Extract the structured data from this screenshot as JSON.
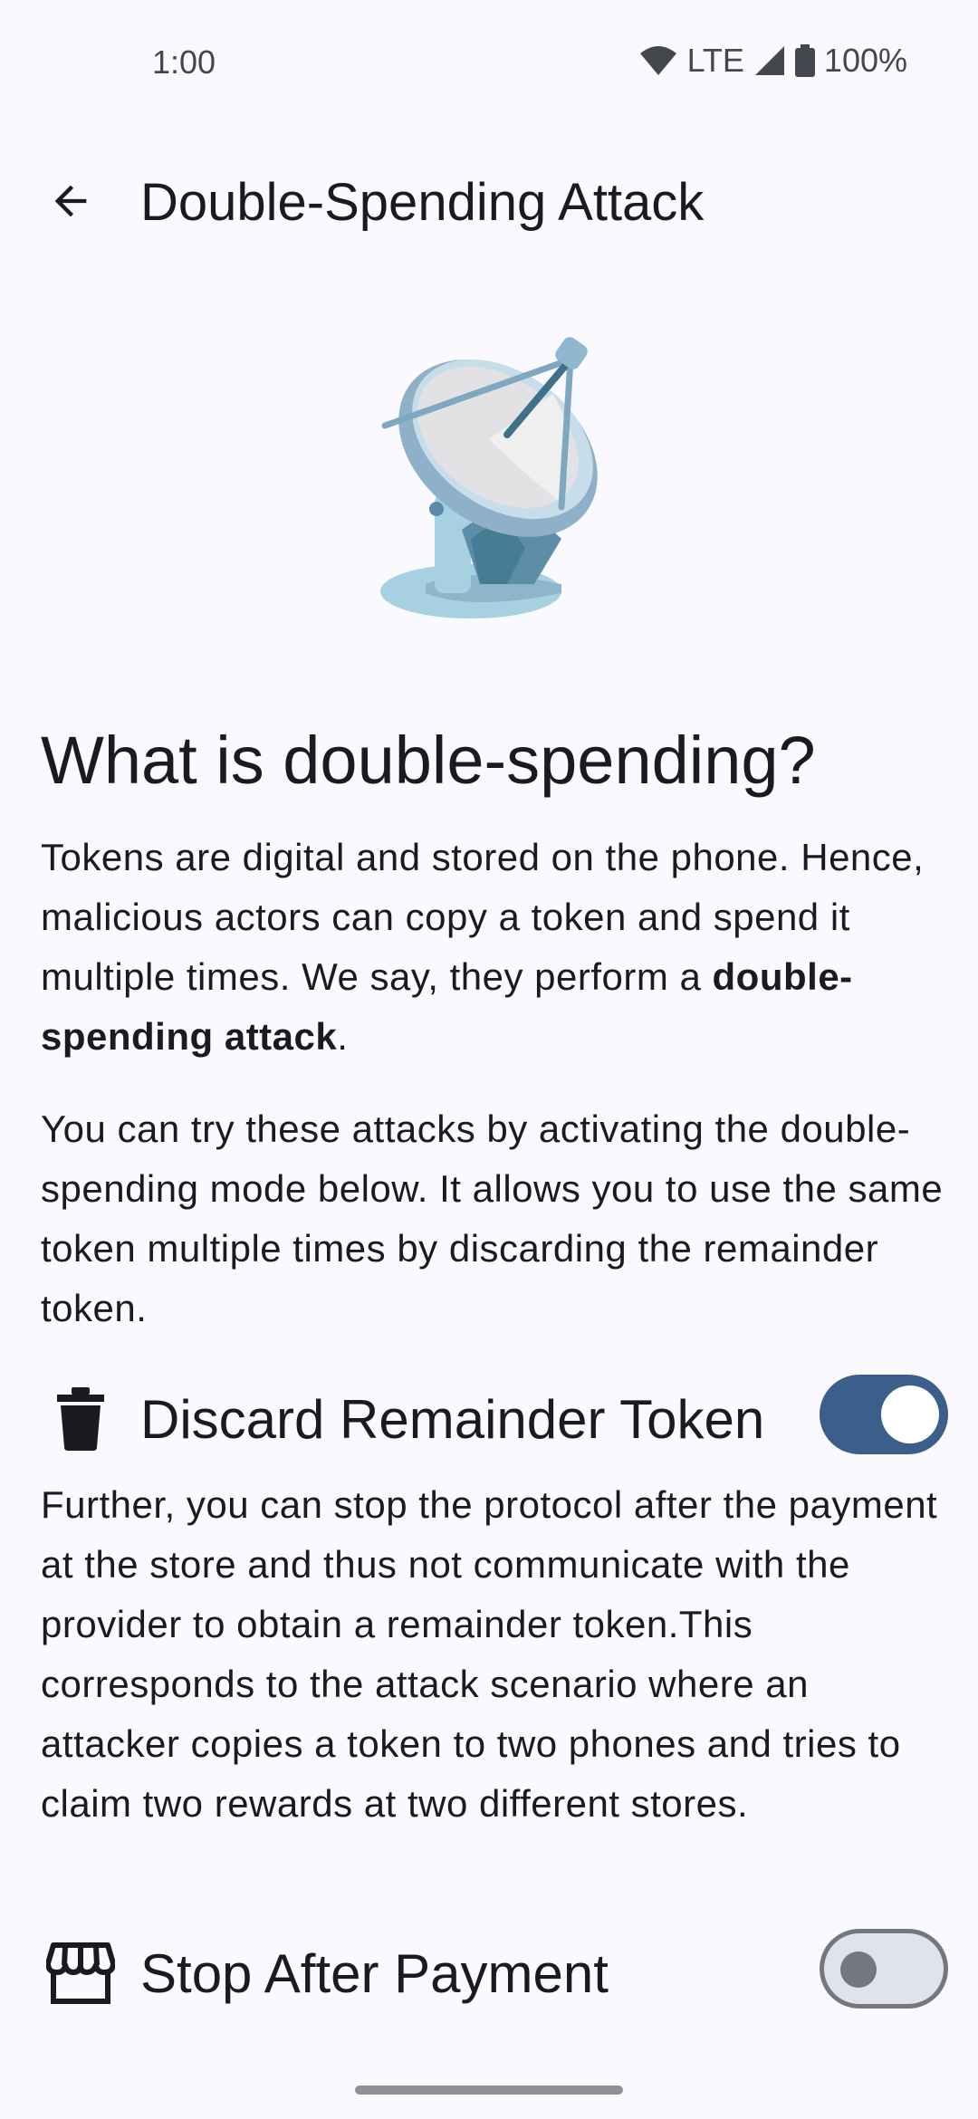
{
  "status": {
    "time": "1:00",
    "network": "LTE",
    "battery": "100%"
  },
  "top_bar": {
    "title": "Double-Spending Attack",
    "back_icon": "arrow-back-icon"
  },
  "hero": {
    "icon": "satellite-dish-icon"
  },
  "content": {
    "heading": "What is double-spending?",
    "p1_text": "Tokens are digital and stored on the phone. Hence, malicious actors can copy a token and spend it multiple times. We say, they perform a ",
    "p1_bold": "double-spending attack",
    "p1_end": ".",
    "p2": "You can try these attacks by activating the double-spending mode below. It allows you to use the same token multiple times by discarding the remainder token.",
    "p3": "Further, you can stop the protocol after the payment at the store and thus not communicate with the provider to obtain a remainder token.This corresponds to the attack scenario where an attacker copies a token to two phones and tries to claim two rewards at two different stores."
  },
  "settings": {
    "discard": {
      "label": "Discard Remainder Token",
      "icon": "trash-icon",
      "enabled": true
    },
    "stop": {
      "label": "Stop After Payment",
      "icon": "store-icon",
      "enabled": false
    }
  },
  "colors": {
    "background": "#FAF9FD",
    "toggle_on": "#3B5F8A",
    "toggle_off_track": "#E0E2EC",
    "toggle_off_outline": "#74777F"
  }
}
